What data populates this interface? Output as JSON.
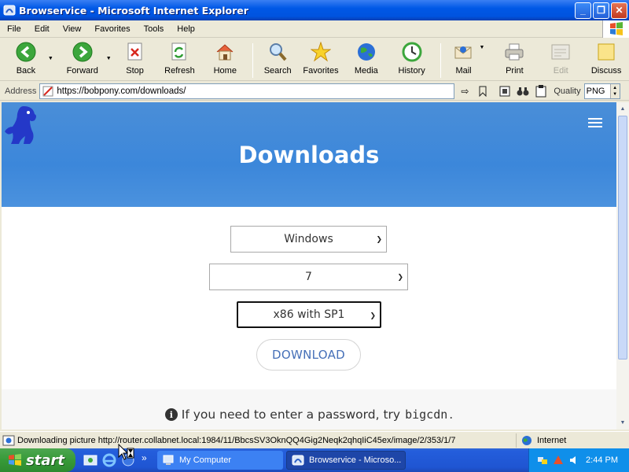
{
  "window": {
    "title": "Browservice - Microsoft Internet Explorer",
    "controls": {
      "minimize": "_",
      "maximize": "❐",
      "close": "✕"
    }
  },
  "menu": [
    "File",
    "Edit",
    "View",
    "Favorites",
    "Tools",
    "Help"
  ],
  "toolbar": {
    "back": "Back",
    "forward": "Forward",
    "stop": "Stop",
    "refresh": "Refresh",
    "home": "Home",
    "search": "Search",
    "favorites": "Favorites",
    "media": "Media",
    "history": "History",
    "mail": "Mail",
    "print": "Print",
    "edit": "Edit",
    "discuss": "Discuss"
  },
  "address": {
    "label": "Address",
    "url": "https://bobpony.com/downloads/",
    "quality_label": "Quality",
    "quality_value": "PNG"
  },
  "page": {
    "heading": "Downloads",
    "os_select": "Windows",
    "version_select": "7",
    "arch_select": "x86 with SP1",
    "download_button": "DOWNLOAD",
    "note_prefix": "If you need to enter a password, try",
    "note_code": "bigcdn",
    "note_suffix": "."
  },
  "status": {
    "text": "Downloading picture http://router.collabnet.local:1984/11/BbcsSV3OknQQ4Gig2Neqk2qhqIiC45ex/image/2/353/1/7",
    "zone": "Internet"
  },
  "taskbar": {
    "start": "start",
    "more": "»",
    "tasks": [
      "My Computer",
      "Browservice - Microso..."
    ],
    "clock": "2:44 PM"
  },
  "colors": {
    "hero": "#3C87DA",
    "titlebar": "#0058E6",
    "download_text": "#4670B8",
    "start_green": "#379A38"
  }
}
